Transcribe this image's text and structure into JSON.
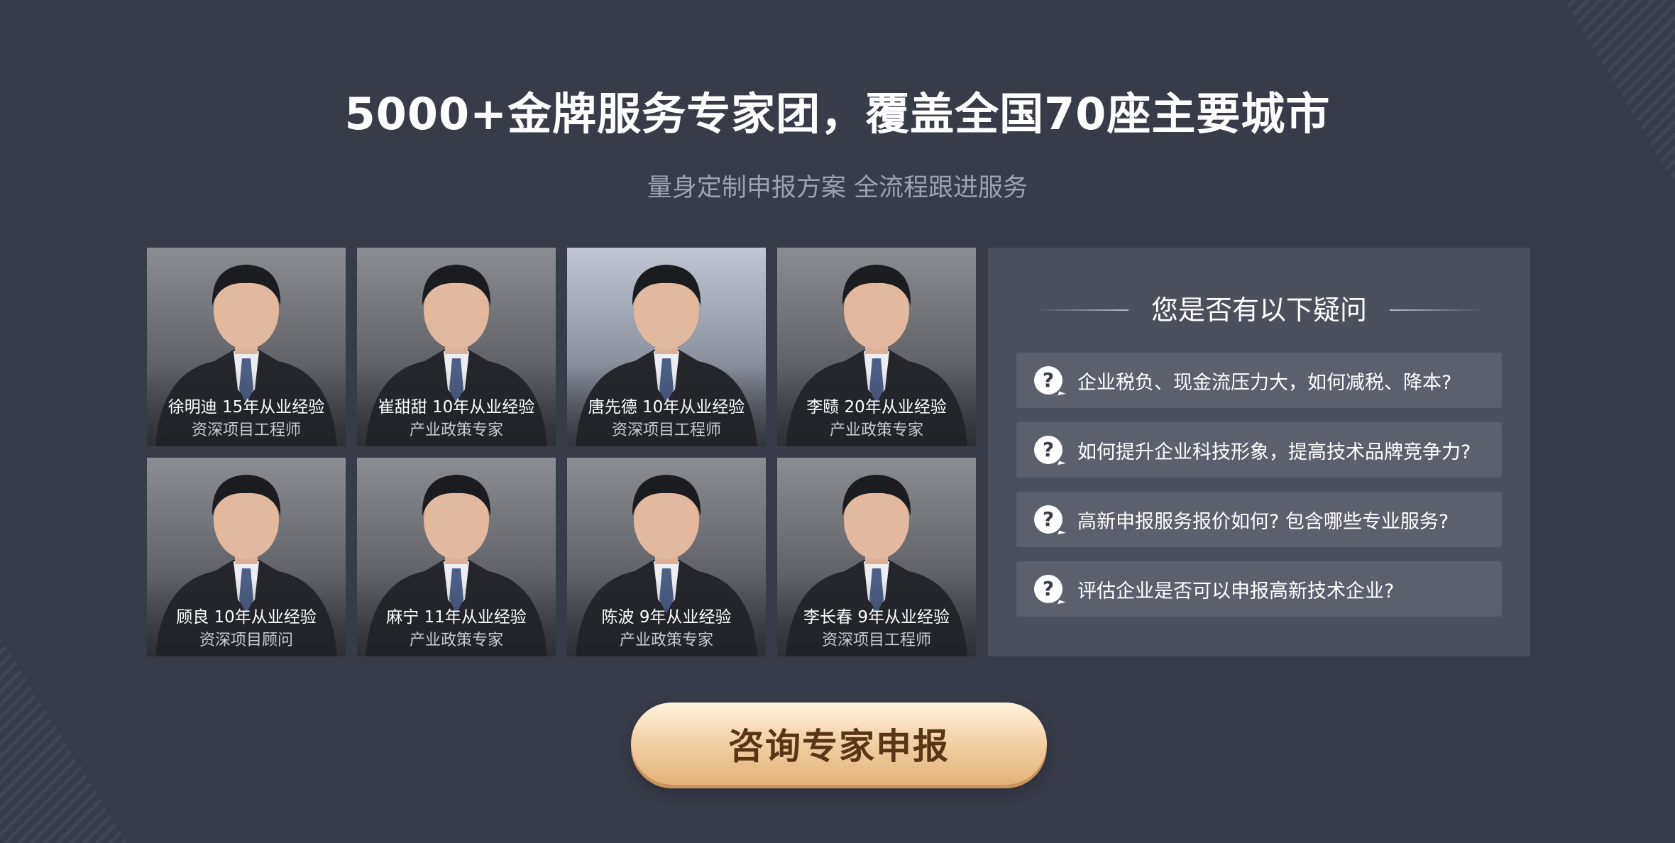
{
  "header": {
    "title": "5000+金牌服务专家团，覆盖全国70座主要城市",
    "subtitle": "量身定制申报方案 全流程跟进服务"
  },
  "experts": [
    {
      "name_line": "徐明迪 15年从业经验",
      "role": "资深项目工程师"
    },
    {
      "name_line": "崔甜甜 10年从业经验",
      "role": "产业政策专家"
    },
    {
      "name_line": "唐先德 10年从业经验",
      "role": "资深项目工程师"
    },
    {
      "name_line": "李赜 20年从业经验",
      "role": "产业政策专家"
    },
    {
      "name_line": "顾良 10年从业经验",
      "role": "资深项目顾问"
    },
    {
      "name_line": "麻宁 11年从业经验",
      "role": "产业政策专家"
    },
    {
      "name_line": "陈波 9年从业经验",
      "role": "产业政策专家"
    },
    {
      "name_line": "李长春 9年从业经验",
      "role": "资深项目工程师"
    }
  ],
  "faq": {
    "title": "您是否有以下疑问",
    "icon": "question-icon",
    "items": [
      "企业税负、现金流压力大，如何减税、降本?",
      "如何提升企业科技形象，提高技术品牌竞争力?",
      "高新申报服务报价如何? 包含哪些专业服务?",
      "评估企业是否可以申报高新技术企业?"
    ]
  },
  "cta": {
    "label": "咨询专家申报"
  },
  "colors": {
    "background": "#383c49",
    "panel": "#4c505d",
    "faq_item": "#5c606d",
    "cta_gold": "#f2cfa2",
    "cta_text": "#5a3414"
  }
}
